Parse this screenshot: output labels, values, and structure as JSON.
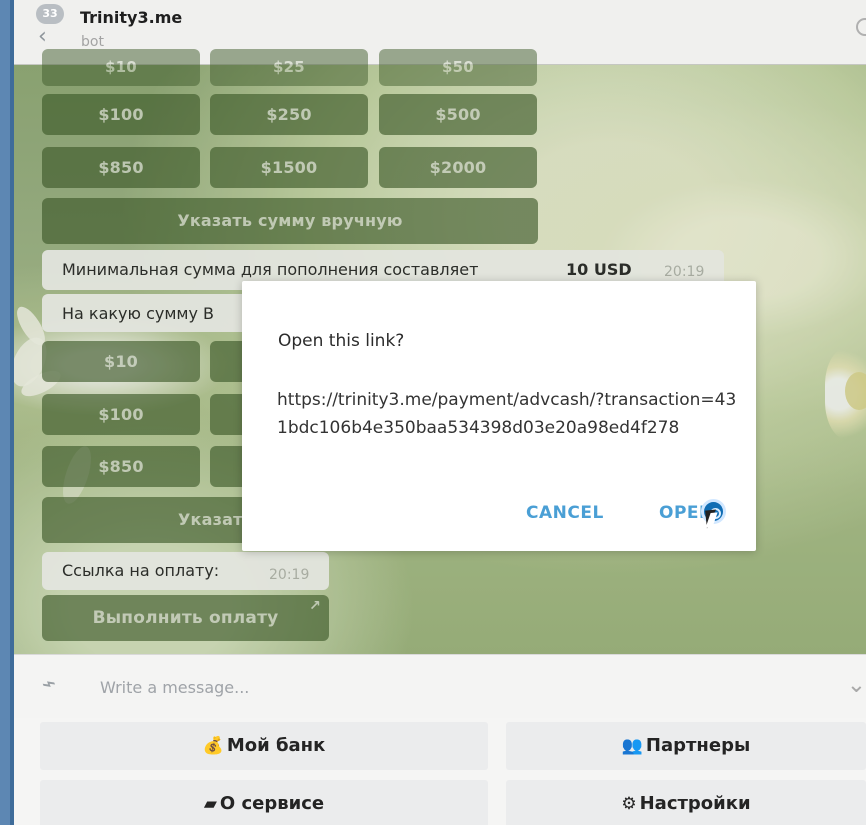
{
  "header": {
    "unread_count": "33",
    "title": "Trinity3.me",
    "subtitle": "bot"
  },
  "chat": {
    "top_amounts": [
      "$10",
      "$25",
      "$50",
      "$100",
      "$250",
      "$500",
      "$850",
      "$1500",
      "$2000"
    ],
    "manual_amount": "Указать сумму вручную",
    "min_message_prefix": "Минимальная сумма для пополнения составляет ",
    "min_message_value": "10 USD",
    "min_message_time": "20:19",
    "question_message": "На какую сумму В",
    "lower_amounts": [
      "$10",
      "$100",
      "$850"
    ],
    "lower_manual_partial": "Указать",
    "payment_link_label": "Ссылка на оплату:",
    "payment_link_time": "20:19",
    "pay_button": "Выполнить оплату",
    "pay_button_arrow": "↗"
  },
  "dialog": {
    "title": "Open this link?",
    "url": "https://trinity3.me/payment/advcash/?transaction=431bdc106b4e350baa534398d03e20a98ed4f278",
    "cancel": "CANCEL",
    "open": "OPEN"
  },
  "input": {
    "placeholder": "Write a message..."
  },
  "reply_keyboard": {
    "bank": "Мой банк",
    "partners": "Партнеры",
    "about": "О сервисе",
    "settings": "Настройки",
    "bank_icon": "money-bag-icon",
    "partners_icon": "people-icon",
    "about_icon": "info-icon",
    "settings_icon": "gear-icon"
  }
}
